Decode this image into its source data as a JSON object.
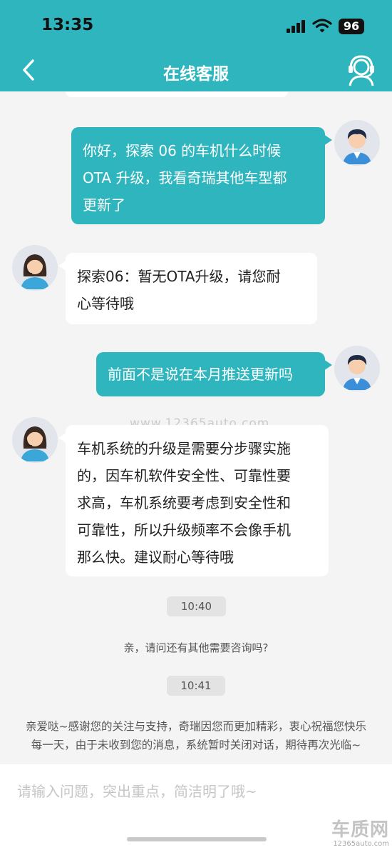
{
  "status_bar": {
    "time": "13:35",
    "battery": "96"
  },
  "nav": {
    "title": "在线客服"
  },
  "messages": {
    "m1": {
      "line1": "你好，探索 06 的车机什么时候",
      "line2": "OTA 升级，我看奇瑞其他车型都",
      "line3": "更新了"
    },
    "m2": {
      "line1": "探索06：暂无OTA升级，请您耐",
      "line2": "心等待哦"
    },
    "m3": {
      "line1": "前面不是说在本月推送更新吗"
    },
    "m4": {
      "line1": "车机系统的升级是需要分步骤实施",
      "line2": "的，因车机软件安全性、可靠性要",
      "line3": "求高，车机系统要考虑到安全性和",
      "line4": "可靠性，所以升级频率不会像手机",
      "line5": "那么快。建议耐心等待哦"
    }
  },
  "time_1": "10:40",
  "system_question": "亲，请问还有其他需要咨询吗?",
  "time_2": "10:41",
  "closing": {
    "line1": "亲爱哒~感谢您的关注与支持，奇瑞因您而更加精彩，衷心祝福您快乐",
    "line2": "每一天，由于未收到您的消息，系统暂时关闭对话，期待再次光临~"
  },
  "watermark": "www.12365auto.com",
  "input": {
    "placeholder": "请输入问题，突出重点，简洁明了哦~"
  },
  "logo": {
    "top": "车质网",
    "bottom": "12365auto.com"
  },
  "colors": {
    "brand": "#2eb5bd",
    "background": "#f4f4f4"
  }
}
